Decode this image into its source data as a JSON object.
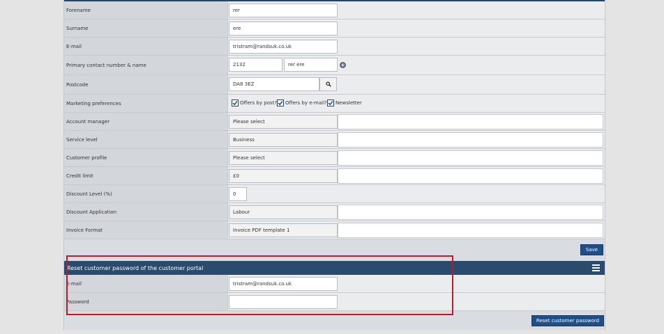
{
  "form": {
    "forename": {
      "label": "Forename",
      "value": "rer"
    },
    "surname": {
      "label": "Surname",
      "value": "ere"
    },
    "email": {
      "label": "E-mail",
      "value": "tristram@randsuk.co.uk"
    },
    "contact": {
      "label": "Primary contact number & name",
      "number": "2132",
      "name": "rer ere",
      "add_icon": "plus-circle-icon"
    },
    "postcode": {
      "label": "Postcode",
      "value": "DA8 3EZ",
      "search_icon": "search-icon"
    },
    "marketing": {
      "label": "Marketing preferences",
      "options": [
        {
          "label": "Offers by post?",
          "checked": true
        },
        {
          "label": "Offers by e-mail?",
          "checked": true
        },
        {
          "label": "Newsletter",
          "checked": true
        }
      ]
    },
    "account_manager": {
      "label": "Account manager",
      "value": "Please select"
    },
    "service_level": {
      "label": "Service level",
      "value": "Business"
    },
    "customer_profile": {
      "label": "Customer profile",
      "value": "Please select"
    },
    "credit_limit": {
      "label": "Credit limit",
      "value": "£0"
    },
    "discount_level": {
      "label": "Discount Level (%)",
      "value": "0"
    },
    "discount_application": {
      "label": "Discount Application",
      "value": "Labour"
    },
    "invoice_format": {
      "label": "Invoice Format",
      "value": "Invoice PDF template 1"
    },
    "save_label": "Save"
  },
  "reset": {
    "title": "Reset customer password of the customer portal",
    "menu_icon": "hamburger-icon",
    "email": {
      "label": "E-mail",
      "value": "tristram@randsuk.co.uk"
    },
    "password": {
      "label": "Password",
      "value": ""
    },
    "button_label": "Reset customer password"
  },
  "colors": {
    "accent": "#1f4f86",
    "header": "#2a4a6e",
    "highlight": "#b0202a"
  }
}
